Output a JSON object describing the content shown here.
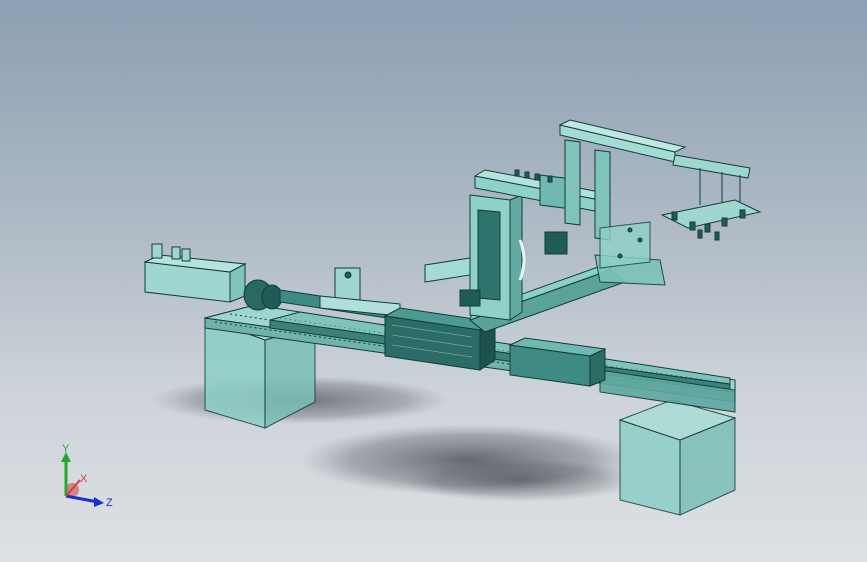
{
  "triad": {
    "y_label": "Y",
    "x_label": "X",
    "z_label": "Z"
  },
  "colors": {
    "body": "#9fd6cf",
    "edge": "#0f3d3a",
    "dark_part": "#1f5c57",
    "axis_y": "#27a82d",
    "axis_z": "#1b2fd0",
    "axis_x": "#d43b3b"
  }
}
